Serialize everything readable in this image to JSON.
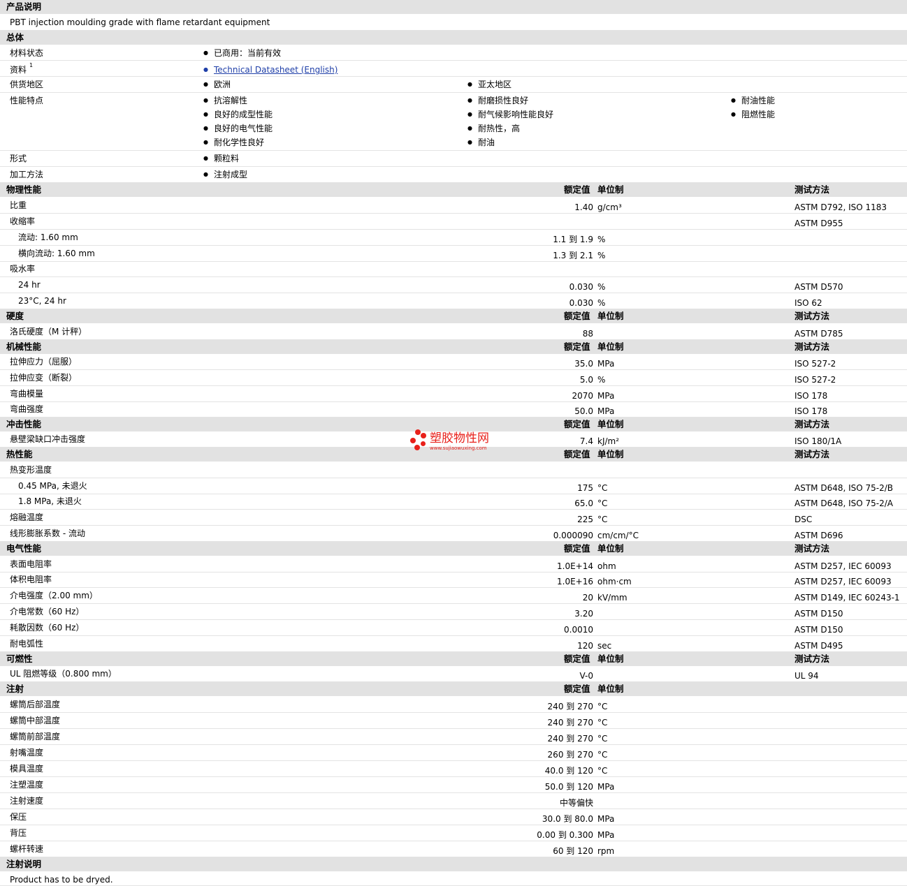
{
  "product": {
    "heading": "产品说明",
    "description": "PBT injection moulding grade with flame retardant equipment"
  },
  "general": {
    "heading": "总体",
    "material_status": {
      "label": "材料状态",
      "value": "已商用：当前有效"
    },
    "documents": {
      "label": "资料",
      "sup": "1",
      "link": "Technical Datasheet (English)"
    },
    "availability": {
      "label": "供货地区",
      "values": [
        "欧洲",
        "亚太地区"
      ]
    },
    "features": {
      "label": "性能特点",
      "col1": [
        "抗溶解性",
        "良好的成型性能",
        "良好的电气性能",
        "耐化学性良好"
      ],
      "col2": [
        "耐磨损性良好",
        "耐气候影响性能良好",
        "耐热性，高",
        "耐油"
      ],
      "col3": [
        "耐油性能",
        "阻燃性能"
      ]
    },
    "form": {
      "label": "形式",
      "value": "颗粒料"
    },
    "processing": {
      "label": "加工方法",
      "value": "注射成型"
    }
  },
  "headers": {
    "nominal": "额定值",
    "unit": "单位制",
    "method": "测试方法"
  },
  "physical": {
    "heading": "物理性能",
    "rows": [
      {
        "label": "比重",
        "value": "1.40",
        "unit": "g/cm³",
        "method": "ASTM D792, ISO 1183"
      },
      {
        "label": "收缩率",
        "value": "",
        "unit": "",
        "method": "ASTM D955"
      },
      {
        "label": "流动: 1.60 mm",
        "value": "1.1 到  1.9",
        "unit": "%",
        "method": ""
      },
      {
        "label": "横向流动: 1.60 mm",
        "value": "1.3 到  2.1",
        "unit": "%",
        "method": ""
      },
      {
        "label": "吸水率",
        "value": "",
        "unit": "",
        "method": ""
      },
      {
        "label": "24 hr",
        "value": "0.030",
        "unit": "%",
        "method": "ASTM D570"
      },
      {
        "label": "23°C, 24 hr",
        "value": "0.030",
        "unit": "%",
        "method": "ISO 62"
      }
    ]
  },
  "hardness": {
    "heading": "硬度",
    "rows": [
      {
        "label": "洛氏硬度（M 计秤）",
        "value": "88",
        "unit": "",
        "method": "ASTM D785"
      }
    ]
  },
  "mechanical": {
    "heading": "机械性能",
    "rows": [
      {
        "label": "拉伸应力（屈服）",
        "value": "35.0",
        "unit": "MPa",
        "method": "ISO 527-2"
      },
      {
        "label": "拉伸应变（断裂）",
        "value": "5.0",
        "unit": "%",
        "method": "ISO 527-2"
      },
      {
        "label": "弯曲模量",
        "value": "2070",
        "unit": "MPa",
        "method": "ISO 178"
      },
      {
        "label": "弯曲强度",
        "value": "50.0",
        "unit": "MPa",
        "method": "ISO 178"
      }
    ]
  },
  "impact": {
    "heading": "冲击性能",
    "rows": [
      {
        "label": "悬壁梁缺口冲击强度",
        "value": "7.4",
        "unit": "kJ/m²",
        "method": "ISO 180/1A"
      }
    ]
  },
  "thermal": {
    "heading": "热性能",
    "rows": [
      {
        "label": "热变形温度",
        "value": "",
        "unit": "",
        "method": ""
      },
      {
        "label": "0.45 MPa, 未退火",
        "value": "175",
        "unit": "°C",
        "method": "ASTM D648, ISO 75-2/B"
      },
      {
        "label": "1.8 MPa, 未退火",
        "value": "65.0",
        "unit": "°C",
        "method": "ASTM D648, ISO 75-2/A"
      },
      {
        "label": "熔融温度",
        "value": "225",
        "unit": "°C",
        "method": "DSC"
      },
      {
        "label": "线形膨胀系数 - 流动",
        "value": "0.000090",
        "unit": "cm/cm/°C",
        "method": "ASTM D696"
      }
    ]
  },
  "electrical": {
    "heading": "电气性能",
    "rows": [
      {
        "label": "表面电阻率",
        "value": "1.0E+14",
        "unit": "ohm",
        "method": "ASTM D257, IEC 60093"
      },
      {
        "label": "体积电阻率",
        "value": "1.0E+16",
        "unit": "ohm·cm",
        "method": "ASTM D257, IEC 60093"
      },
      {
        "label": "介电强度（2.00 mm）",
        "value": "20",
        "unit": "kV/mm",
        "method": "ASTM D149, IEC 60243-1"
      },
      {
        "label": "介电常数（60 Hz）",
        "value": "3.20",
        "unit": "",
        "method": "ASTM D150"
      },
      {
        "label": "耗散因数（60 Hz）",
        "value": "0.0010",
        "unit": "",
        "method": "ASTM D150"
      },
      {
        "label": "耐电弧性",
        "value": "120",
        "unit": "sec",
        "method": "ASTM D495"
      }
    ]
  },
  "flammability": {
    "heading": "可燃性",
    "rows": [
      {
        "label": "UL 阻燃等级（0.800 mm）",
        "value": "V-0",
        "unit": "",
        "method": "UL 94"
      }
    ]
  },
  "injection": {
    "heading": "注射",
    "rows": [
      {
        "label": "螺筒后部温度",
        "value": "240 到  270",
        "unit": "°C"
      },
      {
        "label": "螺筒中部温度",
        "value": "240 到  270",
        "unit": "°C"
      },
      {
        "label": "螺筒前部温度",
        "value": "240 到  270",
        "unit": "°C"
      },
      {
        "label": "射嘴温度",
        "value": "260 到  270",
        "unit": "°C"
      },
      {
        "label": "模具温度",
        "value": "40.0 到  120",
        "unit": "°C"
      },
      {
        "label": "注塑温度",
        "value": "50.0 到  120",
        "unit": "MPa"
      },
      {
        "label": "注射速度",
        "value": "中等偏快",
        "unit": ""
      },
      {
        "label": "保压",
        "value": "30.0 到  80.0",
        "unit": "MPa"
      },
      {
        "label": "背压",
        "value": "0.00 到  0.300",
        "unit": "MPa"
      },
      {
        "label": "螺杆转速",
        "value": "60 到  120",
        "unit": "rpm"
      }
    ]
  },
  "injection_notes": {
    "heading": "注射说明",
    "text": "Product has to be dryed."
  },
  "watermark": {
    "title": "塑胶物性网",
    "url": "www.sujiaowuxing.com"
  }
}
